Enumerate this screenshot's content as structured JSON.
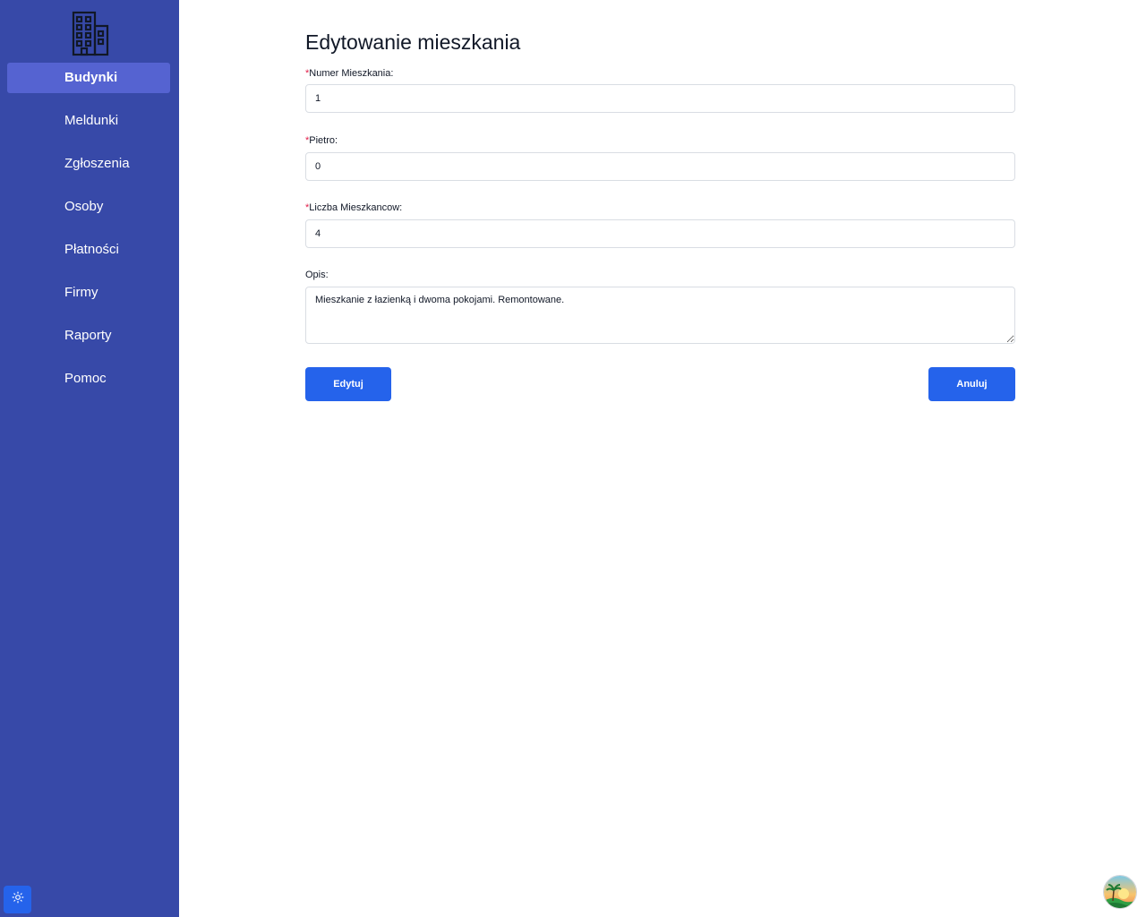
{
  "sidebar": {
    "logo_icon": "building-icon",
    "items": [
      {
        "label": "Budynki",
        "active": true
      },
      {
        "label": "Meldunki",
        "active": false
      },
      {
        "label": "Zgłoszenia",
        "active": false
      },
      {
        "label": "Osoby",
        "active": false
      },
      {
        "label": "Płatności",
        "active": false
      },
      {
        "label": "Firmy",
        "active": false
      },
      {
        "label": "Raporty",
        "active": false
      },
      {
        "label": "Pomoc",
        "active": false
      }
    ],
    "theme_toggle_icon": "sun-icon"
  },
  "form": {
    "title": "Edytowanie mieszkania",
    "required_mark": "*",
    "numer": {
      "label": "Numer Mieszkania:",
      "value": "1"
    },
    "pietro": {
      "label": "Pietro:",
      "value": "0"
    },
    "liczba": {
      "label": "Liczba Mieszkancow:",
      "value": "4"
    },
    "opis": {
      "label": "Opis:",
      "value": "Mieszkanie z łazienką i dwoma pokojami. Remontowane."
    },
    "edit_button": "Edytuj",
    "cancel_button": "Anuluj"
  },
  "avatar_icon": "user-avatar-icon",
  "colors": {
    "sidebar": "#3749a8",
    "sidebar_active": "#5563d1",
    "primary": "#2563eb",
    "required": "#e11d48"
  }
}
